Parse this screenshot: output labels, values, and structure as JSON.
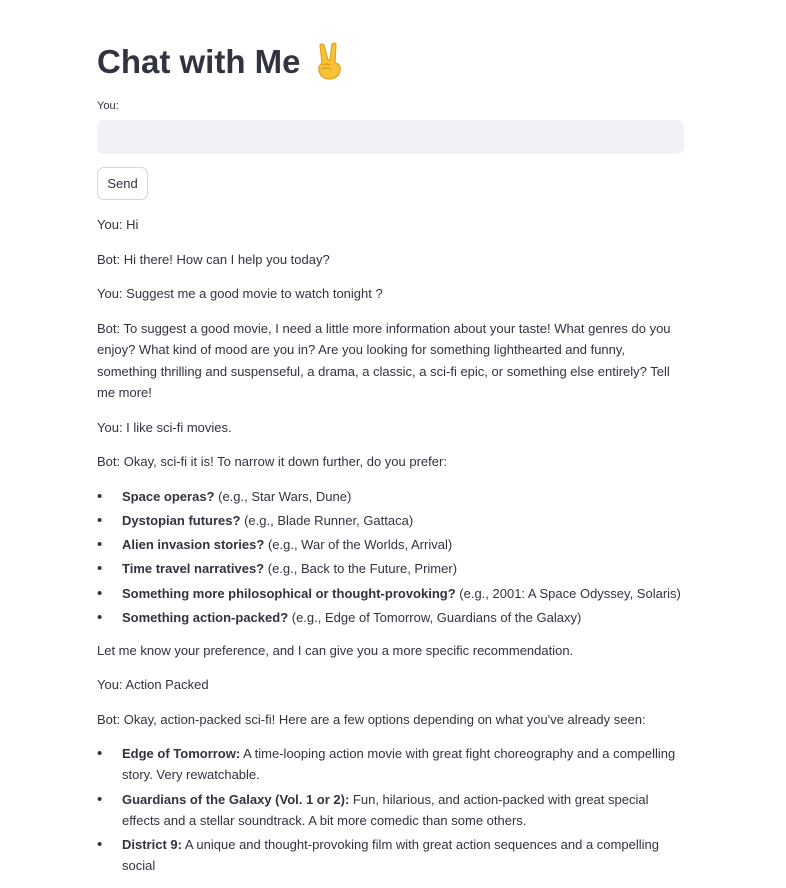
{
  "header": {
    "title": "Chat with Me"
  },
  "input": {
    "label": "You:",
    "value": "",
    "placeholder": ""
  },
  "send_label": "Send",
  "messages": {
    "m1": "You: Hi",
    "m2": "Bot: Hi there! How can I help you today?",
    "m3": "You: Suggest me a good movie to watch tonight ?",
    "m4": "Bot: To suggest a good movie, I need a little more information about your taste! What genres do you enjoy? What kind of mood are you in? Are you looking for something lighthearted and funny, something thrilling and suspenseful, a drama, a classic, a sci-fi epic, or something else entirely? Tell me more!",
    "m5": "You: I like sci-fi movies.",
    "m6": "Bot: Okay, sci-fi it is! To narrow it down further, do you prefer:",
    "subgenres": [
      {
        "bold": "Space operas?",
        "rest": " (e.g., Star Wars, Dune)"
      },
      {
        "bold": "Dystopian futures?",
        "rest": " (e.g., Blade Runner, Gattaca)"
      },
      {
        "bold": "Alien invasion stories?",
        "rest": " (e.g., War of the Worlds, Arrival)"
      },
      {
        "bold": "Time travel narratives?",
        "rest": " (e.g., Back to the Future, Primer)"
      },
      {
        "bold": "Something more philosophical or thought-provoking?",
        "rest": " (e.g., 2001: A Space Odyssey, Solaris)"
      },
      {
        "bold": "Something action-packed?",
        "rest": " (e.g., Edge of Tomorrow, Guardians of the Galaxy)"
      }
    ],
    "m7": "Let me know your preference, and I can give you a more specific recommendation.",
    "m8": "You: Action Packed",
    "m9": "Bot: Okay, action-packed sci-fi! Here are a few options depending on what you've already seen:",
    "recommendations": [
      {
        "bold": "Edge of Tomorrow:",
        "rest": " A time-looping action movie with great fight choreography and a compelling story. Very rewatchable."
      },
      {
        "bold": "Guardians of the Galaxy (Vol. 1 or 2):",
        "rest": " Fun, hilarious, and action-packed with great special effects and a stellar soundtrack. A bit more comedic than some others."
      },
      {
        "bold": "District 9:",
        "rest": " A unique and thought-provoking film with great action sequences and a compelling social"
      }
    ]
  },
  "icons": {
    "title_emoji": "victory-hand-icon"
  }
}
